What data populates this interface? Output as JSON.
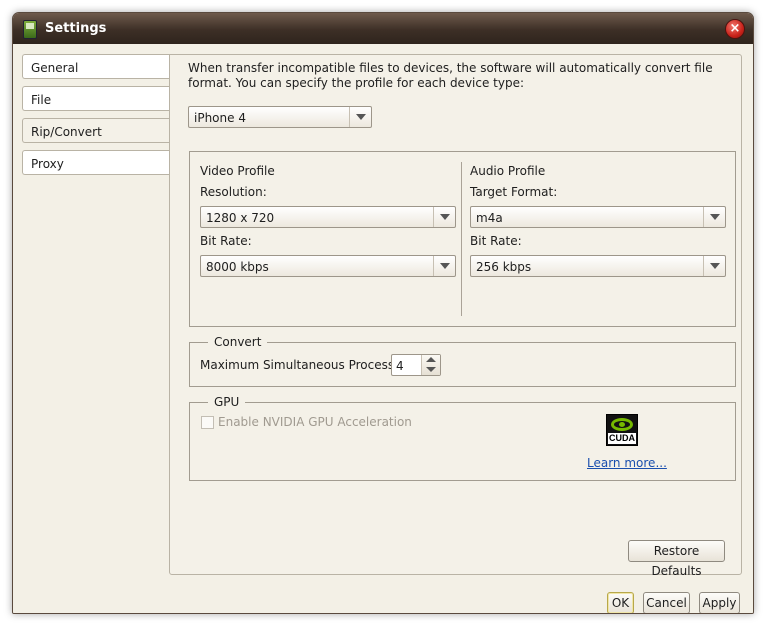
{
  "window": {
    "title": "Settings",
    "app_icon": "phone-icon",
    "close_icon": "close-icon"
  },
  "tabs": [
    {
      "label": "General",
      "active": false
    },
    {
      "label": "File",
      "active": false
    },
    {
      "label": "Rip/Convert",
      "active": true
    },
    {
      "label": "Proxy",
      "active": false
    }
  ],
  "panel": {
    "description": "When transfer incompatible files to devices, the software will automatically convert file format. You can specify the profile for each device type:",
    "device": {
      "selected": "iPhone 4"
    },
    "video_profile": {
      "title": "Video Profile",
      "resolution_label": "Resolution:",
      "resolution": "1280 x 720",
      "bitrate_label": "Bit Rate:",
      "bitrate": "8000 kbps"
    },
    "audio_profile": {
      "title": "Audio Profile",
      "format_label": "Target Format:",
      "format": "m4a",
      "bitrate_label": "Bit Rate:",
      "bitrate": "256 kbps"
    },
    "convert": {
      "title": "Convert",
      "max_processes_label": "Maximum Simultaneous Processes:",
      "max_processes": "4"
    },
    "gpu": {
      "title": "GPU",
      "enable_label": "Enable NVIDIA GPU Acceleration",
      "enabled": false,
      "logo_text": "CUDA",
      "learn_more": "Learn more..."
    },
    "restore_defaults": "Restore Defaults"
  },
  "footer": {
    "ok": "OK",
    "cancel": "Cancel",
    "apply": "Apply"
  },
  "colors": {
    "titlebar": "#3d2f26",
    "link": "#1a4fae",
    "nvidia_green": "#76b900",
    "close": "#c8221a"
  }
}
